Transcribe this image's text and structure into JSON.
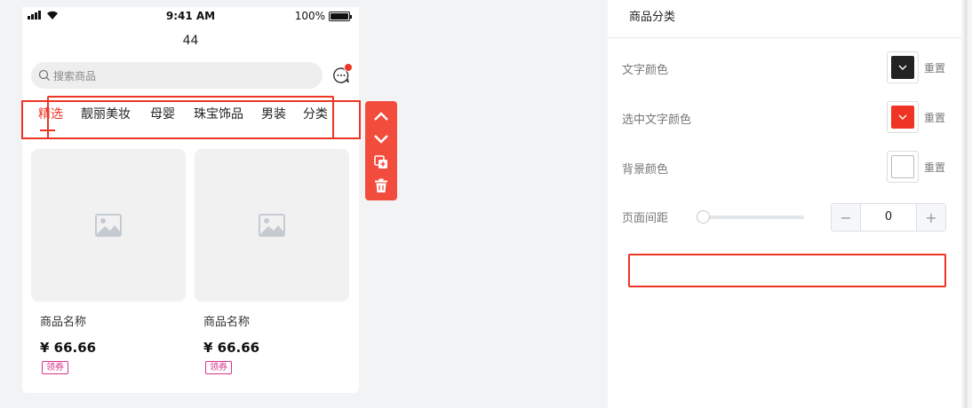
{
  "status_bar": {
    "time": "9:41 AM",
    "battery": "100%"
  },
  "page": {
    "title": "44"
  },
  "search": {
    "placeholder": "搜索商品"
  },
  "tabs": [
    {
      "label": "精选",
      "active": true
    },
    {
      "label": "靓丽美妆",
      "active": false
    },
    {
      "label": "母婴",
      "active": false
    },
    {
      "label": "珠宝饰品",
      "active": false
    },
    {
      "label": "男装",
      "active": false
    },
    {
      "label": "分类",
      "active": false
    }
  ],
  "goods": [
    {
      "name": "商品名称",
      "price": "¥ 66.66",
      "coupon": "领券"
    },
    {
      "name": "商品名称",
      "price": "¥ 66.66",
      "coupon": "领券"
    }
  ],
  "toolbar": {
    "icons": [
      "chevron-up-icon",
      "chevron-down-icon",
      "copy-icon",
      "trash-icon"
    ]
  },
  "panel": {
    "title": "商品分类",
    "text_color": {
      "label": "文字颜色",
      "value": "#222222",
      "reset": "重置"
    },
    "selected_text_color": {
      "label": "选中文字颜色",
      "value": "#ee3525",
      "reset": "重置"
    },
    "background_color": {
      "label": "背景颜色",
      "value": "#ffffff",
      "reset": "重置"
    },
    "page_margin": {
      "label": "页面间距",
      "value": "0",
      "minus": "−",
      "plus": "+"
    }
  },
  "colors": {
    "accent": "#ee3525",
    "toolbar": "#f24d3c",
    "coupon": "#d9338c"
  }
}
